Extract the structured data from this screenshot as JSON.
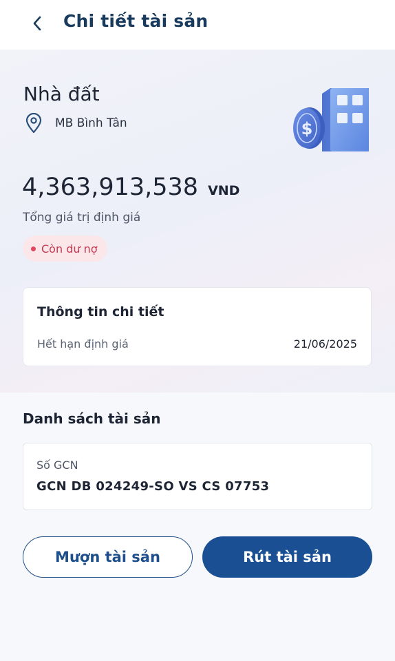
{
  "header": {
    "title": "Chi tiết tài sản",
    "back_icon": "chevron-left-icon"
  },
  "asset": {
    "type": "Nhà đất",
    "location": "MB Bình Tân",
    "location_icon": "location-pin-icon",
    "illustration": "building-with-coin-icon",
    "amount": "4,363,913,538",
    "currency": "VND",
    "amount_label": "Tổng giá trị định giá",
    "status": "Còn dư nợ"
  },
  "details": {
    "title": "Thông tin chi tiết",
    "expiry_label": "Hết hạn định giá",
    "expiry_value": "21/06/2025"
  },
  "asset_list": {
    "heading": "Danh sách tài sản",
    "items": [
      {
        "label": "Số GCN",
        "value": "GCN DB 024249-SO VS CS 07753"
      }
    ]
  },
  "actions": {
    "borrow_label": "Mượn tài sản",
    "withdraw_label": "Rút tài sản"
  },
  "colors": {
    "title": "#183a5c",
    "primary": "#1a4f94",
    "status_bg": "#fbe6ea",
    "status_text": "#c23a50"
  }
}
